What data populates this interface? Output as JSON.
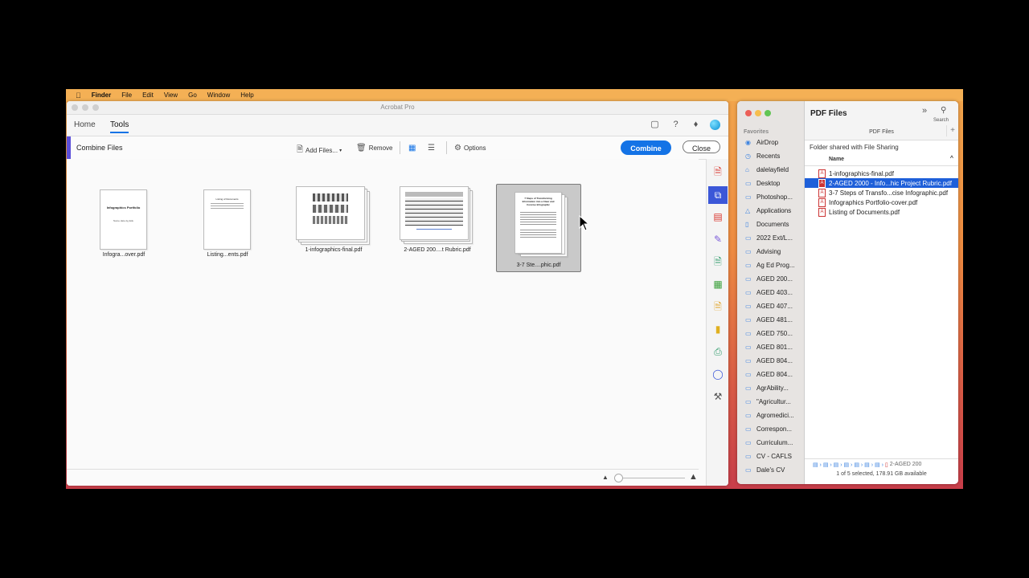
{
  "menubar": {
    "app": "Finder",
    "items": [
      "File",
      "Edit",
      "View",
      "Go",
      "Window",
      "Help"
    ]
  },
  "acrobat": {
    "window_title": "Acrobat Pro",
    "tabs": {
      "home": "Home",
      "tools": "Tools"
    },
    "toolbar": {
      "title": "Combine Files",
      "add_files": "Add Files...",
      "remove": "Remove",
      "options": "Options",
      "combine": "Combine",
      "close": "Close"
    },
    "files": [
      {
        "label": "Infogra...over.pdf",
        "page_title": "Infographics Portfolio",
        "page_sub": "Name date Ag Edu"
      },
      {
        "label": "Listing...ents.pdf",
        "page_title": "Listing of Documents"
      },
      {
        "label": "1-infographics-final.pdf"
      },
      {
        "label": "2-AGED 200....t Rubric.pdf"
      },
      {
        "label": "3-7 Ste....phic.pdf",
        "page_title": "7 Steps of Transforming Information into a Clear and Concise Infographic"
      }
    ],
    "colors": {
      "accent": "#1473e6",
      "tool_accent": "#5b4fd9"
    }
  },
  "finder": {
    "title": "PDF Files",
    "subtitle": "PDF Files",
    "search_label": "Search",
    "shared_label": "Folder shared with File Sharing",
    "column_name": "Name",
    "favorites_label": "Favorites",
    "sidebar": [
      {
        "label": "AirDrop",
        "icon": "airdrop-icon"
      },
      {
        "label": "Recents",
        "icon": "clock-icon"
      },
      {
        "label": "dalelayfield",
        "icon": "home-icon"
      },
      {
        "label": "Desktop",
        "icon": "desktop-icon"
      },
      {
        "label": "Photoshop...",
        "icon": "folder-icon"
      },
      {
        "label": "Applications",
        "icon": "applications-icon"
      },
      {
        "label": "Documents",
        "icon": "document-icon"
      },
      {
        "label": "2022 Ext/L...",
        "icon": "folder-icon"
      },
      {
        "label": "Advising",
        "icon": "folder-icon"
      },
      {
        "label": "Ag Ed Prog...",
        "icon": "folder-icon"
      },
      {
        "label": "AGED 200...",
        "icon": "folder-icon"
      },
      {
        "label": "AGED 403...",
        "icon": "folder-icon"
      },
      {
        "label": "AGED 407...",
        "icon": "folder-icon"
      },
      {
        "label": "AGED 481...",
        "icon": "folder-icon"
      },
      {
        "label": "AGED 750...",
        "icon": "folder-icon"
      },
      {
        "label": "AGED 801...",
        "icon": "folder-icon"
      },
      {
        "label": "AGED 804...",
        "icon": "folder-icon"
      },
      {
        "label": "AGED 804...",
        "icon": "folder-icon"
      },
      {
        "label": "AgrAbility...",
        "icon": "folder-icon"
      },
      {
        "label": "\"Agricultur...",
        "icon": "folder-icon"
      },
      {
        "label": "Agromedici...",
        "icon": "folder-icon"
      },
      {
        "label": "Correspon...",
        "icon": "folder-icon"
      },
      {
        "label": "Curriculum...",
        "icon": "folder-icon"
      },
      {
        "label": "CV - CAFLS",
        "icon": "folder-icon"
      },
      {
        "label": "Dale's CV",
        "icon": "folder-icon"
      }
    ],
    "files": [
      {
        "name": "1-infographics-final.pdf",
        "selected": false
      },
      {
        "name": "2-AGED 2000 - Info...hic Project Rubric.pdf",
        "selected": true
      },
      {
        "name": "3-7 Steps of Transfo...cise Infographic.pdf",
        "selected": false
      },
      {
        "name": "Infographics Portfolio-cover.pdf",
        "selected": false
      },
      {
        "name": "Listing of Documents.pdf",
        "selected": false
      }
    ],
    "path_end": "2-AGED 200",
    "status": "1 of 5 selected, 178.91 GB available"
  }
}
